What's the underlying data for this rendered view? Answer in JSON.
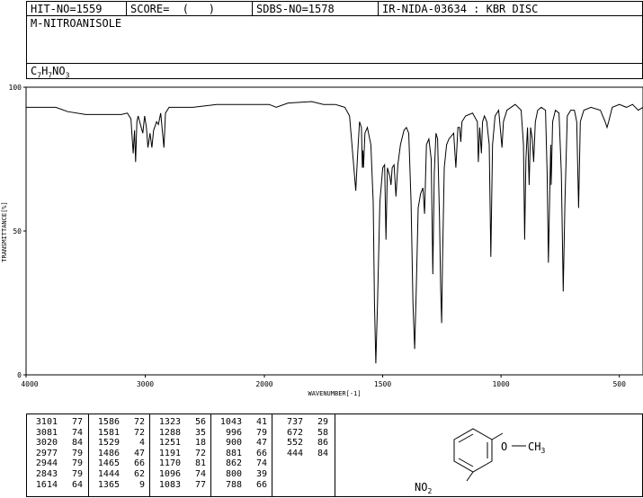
{
  "header": {
    "hit_no": "HIT-NO=1559",
    "score": "SCORE=  (   )",
    "sdbs_no": "SDBS-NO=1578",
    "ir_code": "IR-NIDA-03634 : KBR DISC",
    "compound_name": "M-NITROANISOLE",
    "formula": {
      "c": "C",
      "c_n": "7",
      "h": "H",
      "h_n": "7",
      "no": "NO",
      "o_n": "3"
    }
  },
  "chart_data": {
    "type": "line",
    "xlabel": "WAVENUMBER[-1]",
    "ylabel": "TRANSMITTANCE[%]",
    "xlim": [
      4000,
      400
    ],
    "ylim": [
      0,
      100
    ],
    "x_ticks": [
      "4000",
      "3000",
      "2000",
      "1500",
      "1000",
      "500"
    ],
    "y_ticks": [
      "100",
      "50",
      "0"
    ],
    "x_tick_values": [
      4000,
      3000,
      2000,
      1500,
      1000,
      500
    ],
    "y_tick_values": [
      100,
      50,
      0
    ],
    "series": [
      {
        "points": [
          [
            4000,
            93
          ],
          [
            3750,
            93
          ],
          [
            3650,
            91.5
          ],
          [
            3500,
            90.5
          ],
          [
            3300,
            90.5
          ],
          [
            3200,
            90.5
          ],
          [
            3150,
            91
          ],
          [
            3120,
            89
          ],
          [
            3101,
            77
          ],
          [
            3090,
            85
          ],
          [
            3081,
            74
          ],
          [
            3070,
            88
          ],
          [
            3060,
            90
          ],
          [
            3040,
            87
          ],
          [
            3020,
            84
          ],
          [
            3005,
            90
          ],
          [
            2990,
            86
          ],
          [
            2977,
            79
          ],
          [
            2960,
            84
          ],
          [
            2944,
            79
          ],
          [
            2930,
            85
          ],
          [
            2905,
            88
          ],
          [
            2890,
            87
          ],
          [
            2870,
            91
          ],
          [
            2843,
            79
          ],
          [
            2830,
            91
          ],
          [
            2800,
            93
          ],
          [
            2600,
            93
          ],
          [
            2400,
            94
          ],
          [
            2200,
            94
          ],
          [
            2000,
            94
          ],
          [
            1980,
            94
          ],
          [
            1950,
            93
          ],
          [
            1900,
            94.5
          ],
          [
            1800,
            95
          ],
          [
            1750,
            94
          ],
          [
            1700,
            94
          ],
          [
            1660,
            93
          ],
          [
            1640,
            90
          ],
          [
            1625,
            75
          ],
          [
            1614,
            64
          ],
          [
            1605,
            78
          ],
          [
            1598,
            88
          ],
          [
            1590,
            86
          ],
          [
            1586,
            72
          ],
          [
            1584,
            78
          ],
          [
            1581,
            72
          ],
          [
            1575,
            84
          ],
          [
            1565,
            86
          ],
          [
            1550,
            80
          ],
          [
            1540,
            60
          ],
          [
            1535,
            25
          ],
          [
            1529,
            4
          ],
          [
            1522,
            25
          ],
          [
            1512,
            60
          ],
          [
            1500,
            72
          ],
          [
            1492,
            73
          ],
          [
            1486,
            47
          ],
          [
            1480,
            72
          ],
          [
            1470,
            69
          ],
          [
            1465,
            66
          ],
          [
            1460,
            72
          ],
          [
            1452,
            73
          ],
          [
            1444,
            62
          ],
          [
            1436,
            73
          ],
          [
            1425,
            80
          ],
          [
            1410,
            85
          ],
          [
            1400,
            86
          ],
          [
            1390,
            84
          ],
          [
            1380,
            60
          ],
          [
            1372,
            25
          ],
          [
            1365,
            9
          ],
          [
            1358,
            30
          ],
          [
            1350,
            58
          ],
          [
            1340,
            63
          ],
          [
            1330,
            65
          ],
          [
            1323,
            56
          ],
          [
            1315,
            80
          ],
          [
            1305,
            82
          ],
          [
            1295,
            75
          ],
          [
            1288,
            35
          ],
          [
            1282,
            70
          ],
          [
            1275,
            84
          ],
          [
            1268,
            82
          ],
          [
            1260,
            55
          ],
          [
            1255,
            30
          ],
          [
            1251,
            18
          ],
          [
            1247,
            40
          ],
          [
            1240,
            72
          ],
          [
            1230,
            80
          ],
          [
            1220,
            82
          ],
          [
            1200,
            84
          ],
          [
            1191,
            72
          ],
          [
            1182,
            86
          ],
          [
            1175,
            86
          ],
          [
            1170,
            81
          ],
          [
            1165,
            88
          ],
          [
            1150,
            90
          ],
          [
            1120,
            91
          ],
          [
            1100,
            88
          ],
          [
            1096,
            74
          ],
          [
            1090,
            86
          ],
          [
            1083,
            77
          ],
          [
            1078,
            88
          ],
          [
            1070,
            90
          ],
          [
            1060,
            88
          ],
          [
            1050,
            80
          ],
          [
            1043,
            41
          ],
          [
            1036,
            80
          ],
          [
            1025,
            90
          ],
          [
            1010,
            92
          ],
          [
            996,
            79
          ],
          [
            990,
            88
          ],
          [
            975,
            92
          ],
          [
            940,
            94
          ],
          [
            915,
            92
          ],
          [
            905,
            80
          ],
          [
            900,
            47
          ],
          [
            895,
            75
          ],
          [
            888,
            86
          ],
          [
            881,
            66
          ],
          [
            875,
            86
          ],
          [
            868,
            82
          ],
          [
            862,
            74
          ],
          [
            855,
            88
          ],
          [
            845,
            92
          ],
          [
            830,
            93
          ],
          [
            812,
            92
          ],
          [
            805,
            70
          ],
          [
            800,
            39
          ],
          [
            795,
            60
          ],
          [
            790,
            80
          ],
          [
            788,
            66
          ],
          [
            782,
            88
          ],
          [
            770,
            92
          ],
          [
            755,
            91
          ],
          [
            745,
            70
          ],
          [
            737,
            29
          ],
          [
            730,
            60
          ],
          [
            720,
            90
          ],
          [
            705,
            92
          ],
          [
            690,
            92
          ],
          [
            680,
            88
          ],
          [
            672,
            58
          ],
          [
            665,
            88
          ],
          [
            650,
            92
          ],
          [
            620,
            93
          ],
          [
            580,
            92
          ],
          [
            560,
            88
          ],
          [
            552,
            86
          ],
          [
            545,
            88
          ],
          [
            530,
            93
          ],
          [
            500,
            94
          ],
          [
            470,
            93
          ],
          [
            444,
            94
          ],
          [
            420,
            92
          ],
          [
            400,
            93
          ]
        ]
      }
    ],
    "peak_table": [
      [
        [
          3101,
          77
        ],
        [
          3081,
          74
        ],
        [
          3020,
          84
        ],
        [
          2977,
          79
        ],
        [
          2944,
          79
        ],
        [
          2843,
          79
        ],
        [
          1614,
          64
        ]
      ],
      [
        [
          1586,
          72
        ],
        [
          1581,
          72
        ],
        [
          1529,
          4
        ],
        [
          1486,
          47
        ],
        [
          1465,
          66
        ],
        [
          1444,
          62
        ],
        [
          1365,
          9
        ]
      ],
      [
        [
          1323,
          56
        ],
        [
          1288,
          35
        ],
        [
          1251,
          18
        ],
        [
          1191,
          72
        ],
        [
          1170,
          81
        ],
        [
          1096,
          74
        ],
        [
          1083,
          77
        ]
      ],
      [
        [
          1043,
          41
        ],
        [
          996,
          79
        ],
        [
          900,
          47
        ],
        [
          881,
          66
        ],
        [
          862,
          74
        ],
        [
          800,
          39
        ],
        [
          788,
          66
        ]
      ],
      [
        [
          737,
          29
        ],
        [
          672,
          58
        ],
        [
          552,
          86
        ],
        [
          444,
          84
        ]
      ]
    ]
  },
  "structure": {
    "substituent_top": "O",
    "substituent_top_tail": "CH",
    "substituent_top_sub": "3",
    "substituent_bottom": "NO",
    "substituent_bottom_sub": "2"
  }
}
